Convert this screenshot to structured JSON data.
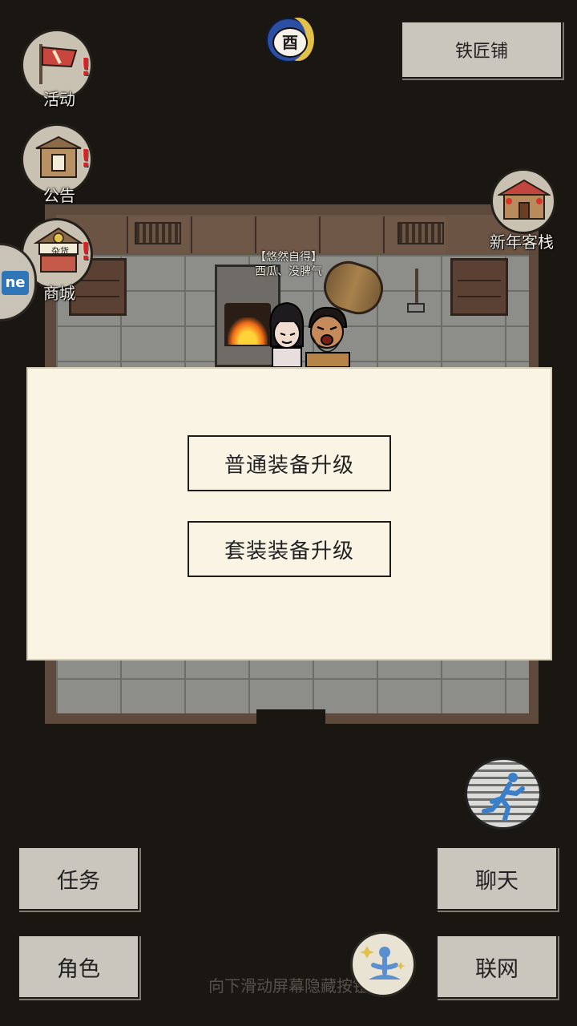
{
  "header": {
    "time_badge": "酉",
    "location_button": "铁匠铺"
  },
  "left_menu": {
    "activity": "活动",
    "announcement": "公告",
    "shop": "商城",
    "shop_sign": "杂货"
  },
  "right_menu": {
    "inn": "新年客栈"
  },
  "side_tab": {
    "label": "ne"
  },
  "npc": {
    "title": "【悠然自得】",
    "name": "西瓜、没脾气"
  },
  "modal": {
    "option_1": "普通装备升级",
    "option_2": "套装装备升级"
  },
  "bottom": {
    "quest": "任务",
    "role": "角色",
    "chat": "聊天",
    "network": "联网",
    "hint": "向下滑动屏幕隐藏按钮"
  },
  "icons": {
    "time": "moon-clock-icon",
    "activity": "flag-icon",
    "announcement": "pavilion-icon",
    "shop": "shop-stall-icon",
    "inn": "inn-building-icon",
    "sprint": "running-man-icon",
    "meditate": "meditation-icon",
    "alert": "exclamation-icon"
  },
  "colors": {
    "background": "#1a1712",
    "modal": "#faf4e5",
    "button": "#c9c6bd",
    "alert": "#d52222",
    "sprint_figure": "#3b7fc8"
  }
}
